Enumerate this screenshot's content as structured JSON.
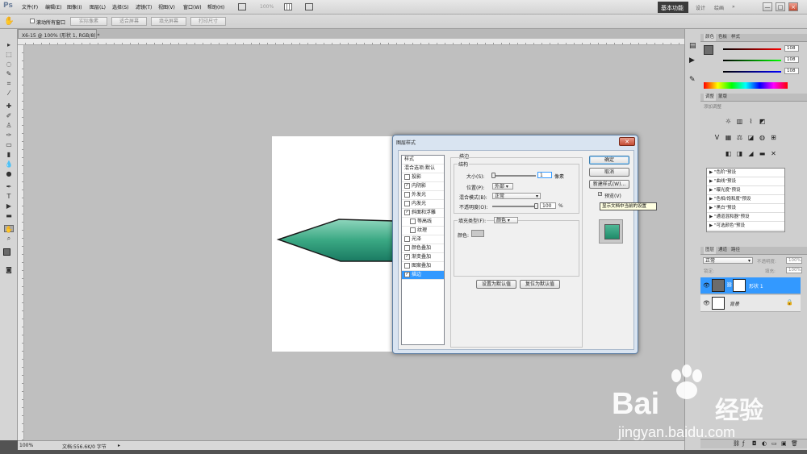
{
  "app": {
    "logo": "Ps"
  },
  "menu": [
    "文件(F)",
    "编辑(E)",
    "图像(I)",
    "图层(L)",
    "选择(S)",
    "滤镜(T)",
    "视图(V)",
    "窗口(W)",
    "帮助(H)"
  ],
  "zoom_display": "100%",
  "workspace": {
    "active": "基本功能",
    "items": [
      "设计",
      "绘画"
    ]
  },
  "window_controls": [
    "—",
    "□",
    "×"
  ],
  "options_bar": {
    "checkbox_label": "滚动所有窗口",
    "buttons": [
      "实际像素",
      "适合屏幕",
      "填充屏幕",
      "打印尺寸"
    ]
  },
  "document": {
    "tab_title": "X6-15 @ 100% (形状 1, RGB/8) *"
  },
  "status": {
    "zoom": "100%",
    "doc_size": "文档:556.6K/0 字节"
  },
  "dialog": {
    "title": "图层样式",
    "style_list": [
      {
        "label": "样式",
        "checked": null,
        "selected": false
      },
      {
        "label": "混合选项:默认",
        "checked": null,
        "selected": false
      },
      {
        "label": "投影",
        "checked": false,
        "selected": false
      },
      {
        "label": "内阴影",
        "checked": true,
        "selected": false
      },
      {
        "label": "外发光",
        "checked": false,
        "selected": false
      },
      {
        "label": "内发光",
        "checked": false,
        "selected": false
      },
      {
        "label": "斜面和浮雕",
        "checked": true,
        "selected": false
      },
      {
        "label": "等高线",
        "checked": false,
        "selected": false,
        "indent": true
      },
      {
        "label": "纹理",
        "checked": false,
        "selected": false,
        "indent": true
      },
      {
        "label": "光泽",
        "checked": false,
        "selected": false
      },
      {
        "label": "颜色叠加",
        "checked": false,
        "selected": false
      },
      {
        "label": "渐变叠加",
        "checked": true,
        "selected": false
      },
      {
        "label": "图案叠加",
        "checked": false,
        "selected": false
      },
      {
        "label": "描边",
        "checked": true,
        "selected": true
      }
    ],
    "section_title": "描边",
    "structure_title": "结构",
    "size_label": "大小(S):",
    "size_value": "1",
    "size_unit": "像素",
    "size_fraction": 0.02,
    "position_label": "位置(P):",
    "position_value": "外部",
    "blend_label": "混合模式(B):",
    "blend_value": "正常",
    "opacity_label": "不透明度(O):",
    "opacity_value": "100",
    "opacity_unit": "%",
    "opacity_fraction": 1.0,
    "fill_type_label": "填充类型(F):",
    "fill_type_value": "颜色",
    "color_label": "颜色:",
    "btn_set_default": "设置为默认值",
    "btn_reset_default": "复位为默认值",
    "btn_ok": "确定",
    "btn_cancel": "取消",
    "btn_new_style": "新建样式(W)...",
    "preview_label": "预览(V)",
    "preview_checked": true
  },
  "tooltip": "显示文档中当前的设置",
  "panels": {
    "color_tabs": [
      "颜色",
      "色板",
      "样式"
    ],
    "rgb_values": [
      "108",
      "108",
      "108"
    ],
    "adjust_tabs": [
      "调整",
      "蒙版"
    ],
    "adjust_hint": "添加调整",
    "presets": [
      "\"色阶\"预设",
      "\"曲线\"预设",
      "\"曝光度\"预设",
      "\"色相/饱和度\"预设",
      "\"黑白\"预设",
      "\"通道混和器\"预设",
      "\"可选颜色\"预设"
    ],
    "layers_tabs": [
      "图层",
      "通道",
      "路径"
    ],
    "blend_mode": "正常",
    "opacity_label": "不透明度:",
    "opacity_value": "100%",
    "lock_label": "锁定:",
    "fill_label": "填充:",
    "fill_value": "100%",
    "layers": [
      {
        "name": "形状 1",
        "selected": true
      },
      {
        "name": "背景",
        "selected": false
      }
    ]
  },
  "watermark": {
    "text": "Bai",
    "text2": "经验",
    "url": "jingyan.baidu.com"
  },
  "colors": {
    "teal_dark": "#1a7a62",
    "teal_light": "#8fd6bd",
    "selection_blue": "#3399ff"
  }
}
